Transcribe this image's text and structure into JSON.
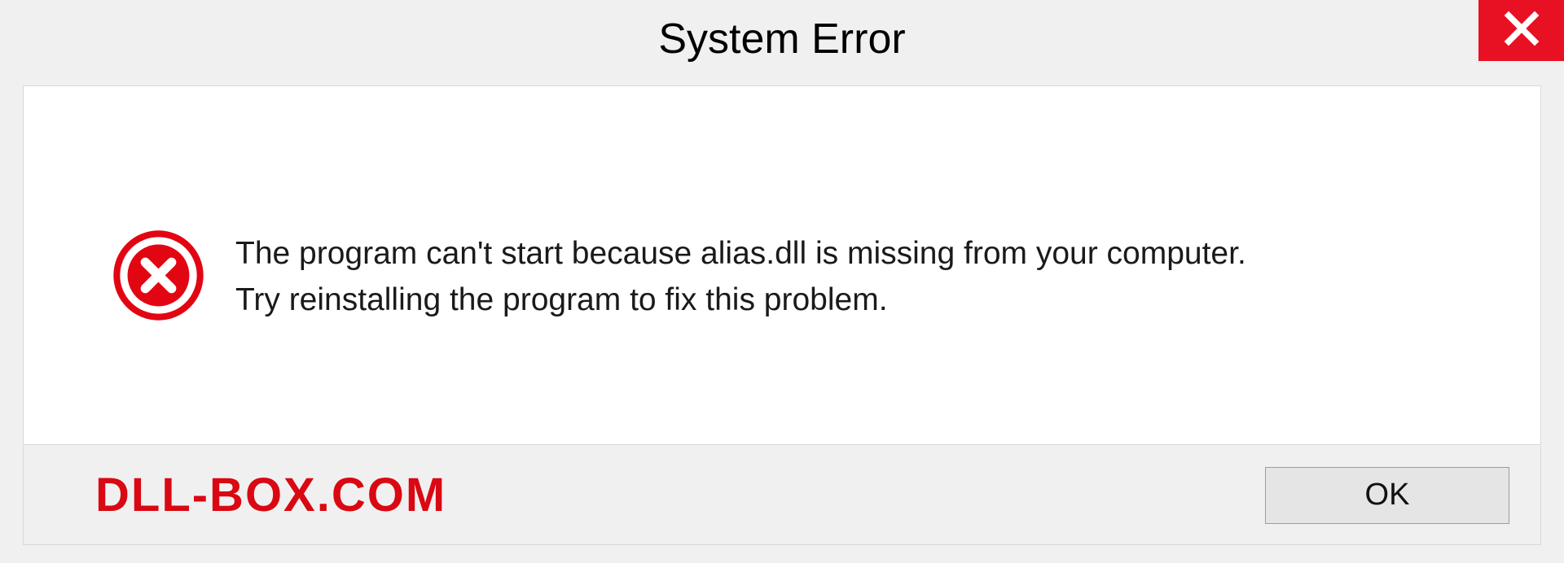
{
  "dialog": {
    "title": "System Error",
    "message_line1": "The program can't start because alias.dll is missing from your computer.",
    "message_line2": "Try reinstalling the program to fix this problem.",
    "ok_label": "OK"
  },
  "watermark": "DLL-BOX.COM",
  "colors": {
    "error_red": "#e20613",
    "close_red": "#e81123"
  }
}
